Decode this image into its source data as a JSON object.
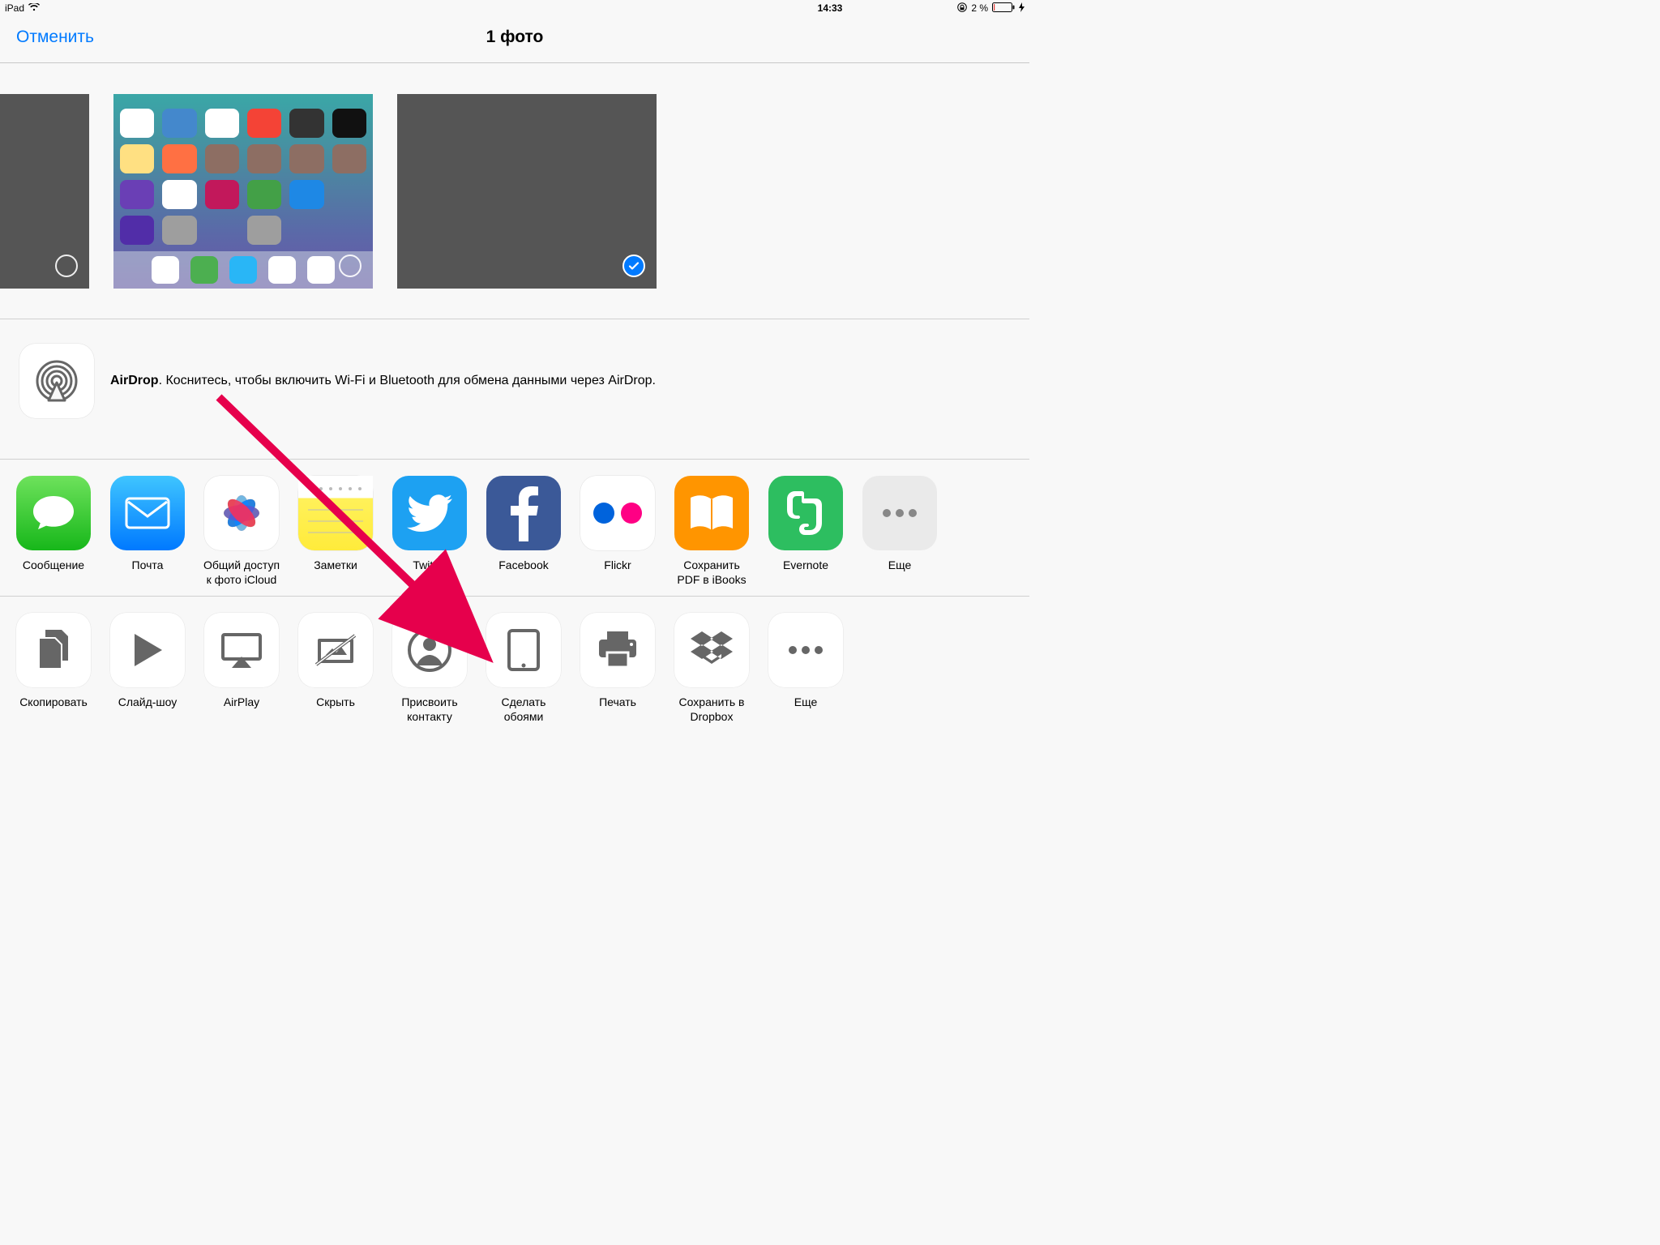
{
  "status": {
    "device": "iPad",
    "time": "14:33",
    "battery_pct": "2 %"
  },
  "nav": {
    "cancel": "Отменить",
    "title": "1 фото"
  },
  "airdrop": {
    "bold": "AirDrop",
    "text": ". Коснитесь, чтобы включить Wi-Fi и Bluetooth для обмена данными через AirDrop."
  },
  "share": {
    "message": "Сообщение",
    "mail": "Почта",
    "icloud": "Общий доступ к фото iCloud",
    "notes": "Заметки",
    "twitter": "Twitter",
    "facebook": "Facebook",
    "flickr": "Flickr",
    "ibooks": "Сохранить PDF в iBooks",
    "evernote": "Evernote",
    "more": "Еще"
  },
  "actions": {
    "copy": "Скопировать",
    "slideshow": "Слайд-шоу",
    "airplay": "AirPlay",
    "hide": "Скрыть",
    "contact": "Присвоить контакту",
    "wallpaper": "Сделать обоями",
    "print": "Печать",
    "dropbox": "Сохранить в Dropbox",
    "more": "Еще"
  }
}
